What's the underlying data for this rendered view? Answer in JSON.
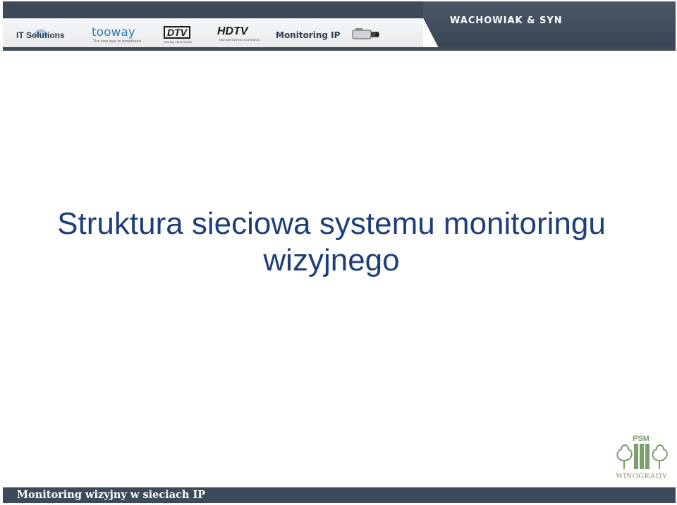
{
  "header": {
    "brand": "WACHOWIAK & SYN",
    "logos": {
      "it_solutions": "IT Solutions",
      "tooway": "tooway",
      "tooway_tagline": "The new way to broadband",
      "dtv": "DTV",
      "dtv_sub": "DIGITAL TELEVISION",
      "hdtv": "HDTV",
      "hdtv_sub": "HIGH DEFINITION TELEVISION",
      "monitoring": "Monitoring IP"
    },
    "icons": [
      "cloud-icon",
      "ip-camera-icon"
    ]
  },
  "slide": {
    "title_line1": "Struktura sieciowa systemu monitoringu",
    "title_line2": "wizyjnego"
  },
  "corner_logo": {
    "letters": "PSM",
    "name": "WINOGRADY"
  },
  "footer": {
    "text": "Monitoring wizyjny w sieciach IP"
  },
  "colors": {
    "header_band": "#3d4a5a",
    "title": "#1d3e78",
    "logo_green": "#7aa06e"
  }
}
